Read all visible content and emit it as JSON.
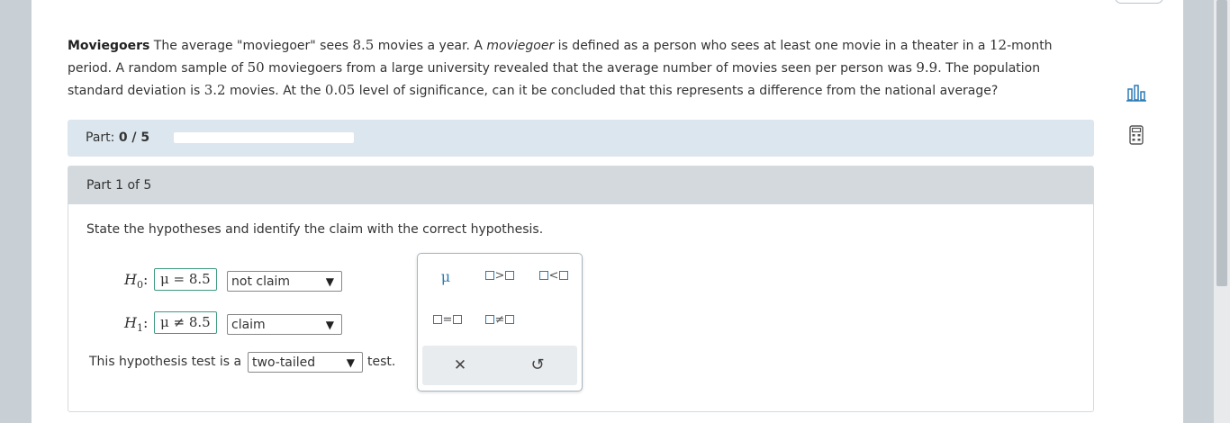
{
  "problem": {
    "title": "Moviegoers",
    "text_1": " The average \"moviegoer\" sees ",
    "value_1": "8.5",
    "text_2": " movies a year. A ",
    "italic_term": "moviegoer",
    "text_3": " is defined as a person who sees at least one movie in a theater in a ",
    "value_2": "12",
    "text_4": "-month period. A random sample of ",
    "value_3": "50",
    "text_5": " moviegoers from a large university revealed that the average number of movies seen per person was ",
    "value_4": "9.9",
    "text_6": ". The population standard deviation is ",
    "value_5": "3.2",
    "text_7": " movies. At the ",
    "value_6": "0.05",
    "text_8": " level of significance, can it be concluded that this represents a difference from the national average?"
  },
  "progress": {
    "label": "Part:",
    "value": "0 / 5",
    "fraction": 0
  },
  "part": {
    "header": "Part 1 of 5",
    "instruction": "State the hypotheses and identify the claim with the correct hypothesis.",
    "h0": {
      "symbol": "H",
      "subscript": "0",
      "colon": ":",
      "answer": "μ = 8.5",
      "selected": "not claim"
    },
    "h1": {
      "symbol": "H",
      "subscript": "1",
      "colon": ":",
      "answer": "μ ≠ 8.5",
      "selected": "claim"
    },
    "test_prefix": "This hypothesis test is a",
    "test_selected": "two-tailed",
    "test_suffix": "test."
  },
  "palette": {
    "mu": "μ",
    "gt": ">",
    "lt": "<",
    "eq": "=",
    "ne": "≠",
    "clear": "✕",
    "undo": "↺"
  },
  "side_icons": {
    "chart": "📊",
    "calculator": "🖩"
  },
  "colors": {
    "accent": "#2a7ab5",
    "answer_border": "#3f9a80",
    "part_bar": "#dce6ee",
    "part_header": "#d3d9dd"
  }
}
